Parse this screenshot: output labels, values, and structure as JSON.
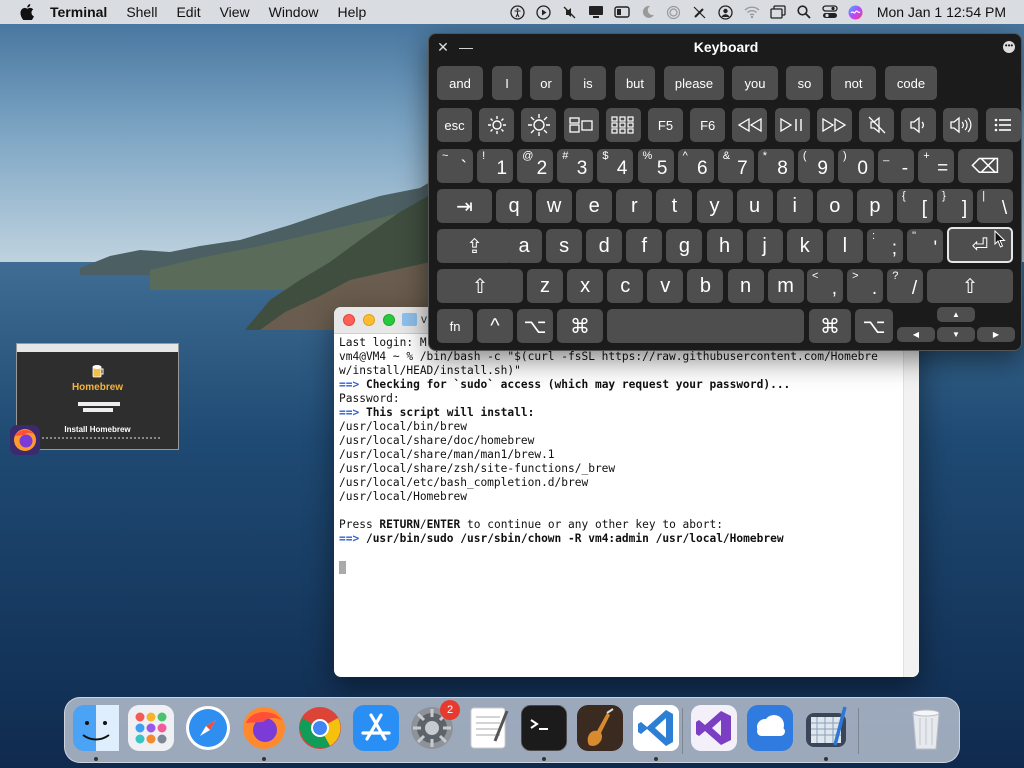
{
  "menubar": {
    "apple_icon": "apple-logo",
    "app_name": "Terminal",
    "menus": [
      "Shell",
      "Edit",
      "View",
      "Window",
      "Help"
    ],
    "status_icons": [
      "accessibility-icon",
      "play-circle-icon",
      "mute-icon",
      "display-icon",
      "screens-icon",
      "moon-icon",
      "airdrop-icon",
      "no-pen-icon",
      "user-icon",
      "wifi-icon",
      "window-icon",
      "search-icon",
      "control-center-icon",
      "siri-icon"
    ],
    "clock": "Mon Jan 1  12:54 PM"
  },
  "thumbnail": {
    "title": "Homebrew",
    "install": "Install Homebrew"
  },
  "terminal": {
    "title": "v",
    "lines": [
      {
        "text": "Last login: M",
        "style": "normal"
      },
      {
        "text": "vm4@VM4 ~ % /bin/bash -c \"$(curl -fsSL https://raw.githubusercontent.com/Homebre",
        "style": "normal"
      },
      {
        "text": "w/install/HEAD/install.sh)\"",
        "style": "normal"
      },
      {
        "arrow": "==>",
        "text": " Checking for `sudo` access (which may request your password)...",
        "style": "bold"
      },
      {
        "text": "Password:",
        "style": "normal"
      },
      {
        "arrow": "==>",
        "text": " This script will install:",
        "style": "bold"
      },
      {
        "text": "/usr/local/bin/brew",
        "style": "normal"
      },
      {
        "text": "/usr/local/share/doc/homebrew",
        "style": "normal"
      },
      {
        "text": "/usr/local/share/man/man1/brew.1",
        "style": "normal"
      },
      {
        "text": "/usr/local/share/zsh/site-functions/_brew",
        "style": "normal"
      },
      {
        "text": "/usr/local/etc/bash_completion.d/brew",
        "style": "normal"
      },
      {
        "text": "/usr/local/Homebrew",
        "style": "normal"
      },
      {
        "text": "",
        "style": "normal"
      },
      {
        "pre": "Press ",
        "bold1": "RETURN",
        "mid": "/",
        "bold2": "ENTER",
        "post": " to continue or any other key to abort:",
        "style": "mixed"
      },
      {
        "arrow": "==>",
        "text": " /usr/bin/sudo /usr/sbin/chown -R vm4:admin /usr/local/Homebrew",
        "style": "bold"
      }
    ]
  },
  "keyboard": {
    "title": "Keyboard",
    "close": "✕",
    "minimize": "—",
    "suggestions": [
      "and",
      "I",
      "or",
      "is",
      "but",
      "please",
      "you",
      "so",
      "not",
      "code"
    ],
    "fn_row": [
      "esc",
      "brightness-down-icon",
      "brightness-up-icon",
      "mission-control-icon",
      "launchpad-icon",
      "F5",
      "F6",
      "rewind-icon",
      "play-pause-icon",
      "fast-forward-icon",
      "mute-icon",
      "volume-down-icon",
      "volume-up-icon",
      "list-icon"
    ],
    "number_row": [
      [
        "~",
        "`"
      ],
      [
        "!",
        "1"
      ],
      [
        "@",
        "2"
      ],
      [
        "#",
        "3"
      ],
      [
        "$",
        "4"
      ],
      [
        "%",
        "5"
      ],
      [
        "^",
        "6"
      ],
      [
        "&",
        "7"
      ],
      [
        "*",
        "8"
      ],
      [
        "(",
        "9"
      ],
      [
        ")",
        "0"
      ],
      [
        "_",
        "-"
      ],
      [
        "+",
        "="
      ]
    ],
    "delete_glyph": "⌫",
    "tab_glyph": "⇥",
    "qwerty_row": [
      "q",
      "w",
      "e",
      "r",
      "t",
      "y",
      "u",
      "i",
      "o",
      "p"
    ],
    "qwerty_extra": [
      [
        "{",
        "["
      ],
      [
        "}",
        "]"
      ],
      [
        "|",
        "\\"
      ]
    ],
    "caps_glyph": "⇪",
    "home_row": [
      "a",
      "s",
      "d",
      "f",
      "g",
      "h",
      "j",
      "k",
      "l"
    ],
    "home_extra": [
      [
        ":",
        ";"
      ],
      [
        "\"",
        "'"
      ]
    ],
    "return_glyph": "⏎",
    "shift_glyph": "⇧",
    "bottom_row": [
      "z",
      "x",
      "c",
      "v",
      "b",
      "n",
      "m"
    ],
    "bottom_extra": [
      [
        "<",
        ","
      ],
      [
        ">",
        "."
      ],
      [
        "?",
        "/"
      ]
    ],
    "space_row": [
      "fn",
      "^",
      "⌥",
      "⌘",
      "",
      "⌘",
      "⌥"
    ],
    "arrows": [
      "▲",
      "◀",
      "▼",
      "▶"
    ]
  },
  "dock": {
    "apps": [
      "Finder",
      "Launchpad",
      "Safari",
      "Firefox",
      "Google Chrome",
      "App Store",
      "System Preferences",
      "TextEdit",
      "Terminal",
      "GarageBand",
      "Visual Studio Code",
      "Visual Studio",
      "Weather",
      "Xcode",
      "Trash"
    ],
    "settings_badge": "2"
  }
}
